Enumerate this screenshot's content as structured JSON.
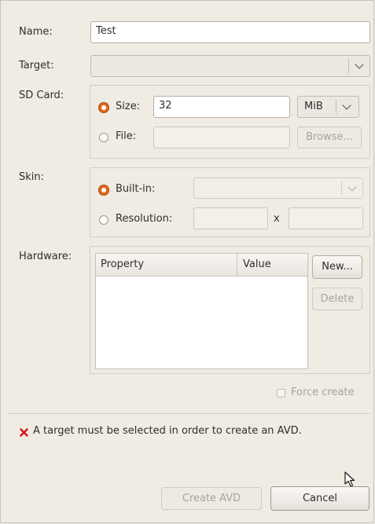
{
  "form": {
    "name_label": "Name:",
    "name_value": "Test",
    "target_label": "Target:",
    "target_value": "",
    "sdcard_label": "SD Card:",
    "size_radio_label": "Size:",
    "size_value": "32",
    "size_unit": "MiB",
    "file_radio_label": "File:",
    "file_value": "",
    "browse_label": "Browse...",
    "skin_label": "Skin:",
    "builtin_radio_label": "Built-in:",
    "builtin_value": "",
    "resolution_radio_label": "Resolution:",
    "resolution_width": "",
    "resolution_x": "x",
    "resolution_height": "",
    "hardware_label": "Hardware:",
    "table_headers": [
      "Property",
      "Value"
    ],
    "new_label": "New...",
    "delete_label": "Delete",
    "force_create_label": "Force create"
  },
  "status": {
    "error_icon": "red-x-icon",
    "error_message": "A target must be selected in order to create an AVD."
  },
  "actions": {
    "create_label": "Create AVD",
    "cancel_label": "Cancel"
  },
  "colors": {
    "background": "#f0ebe3",
    "radio_selected": "#e36a1c",
    "error": "#d01616"
  }
}
